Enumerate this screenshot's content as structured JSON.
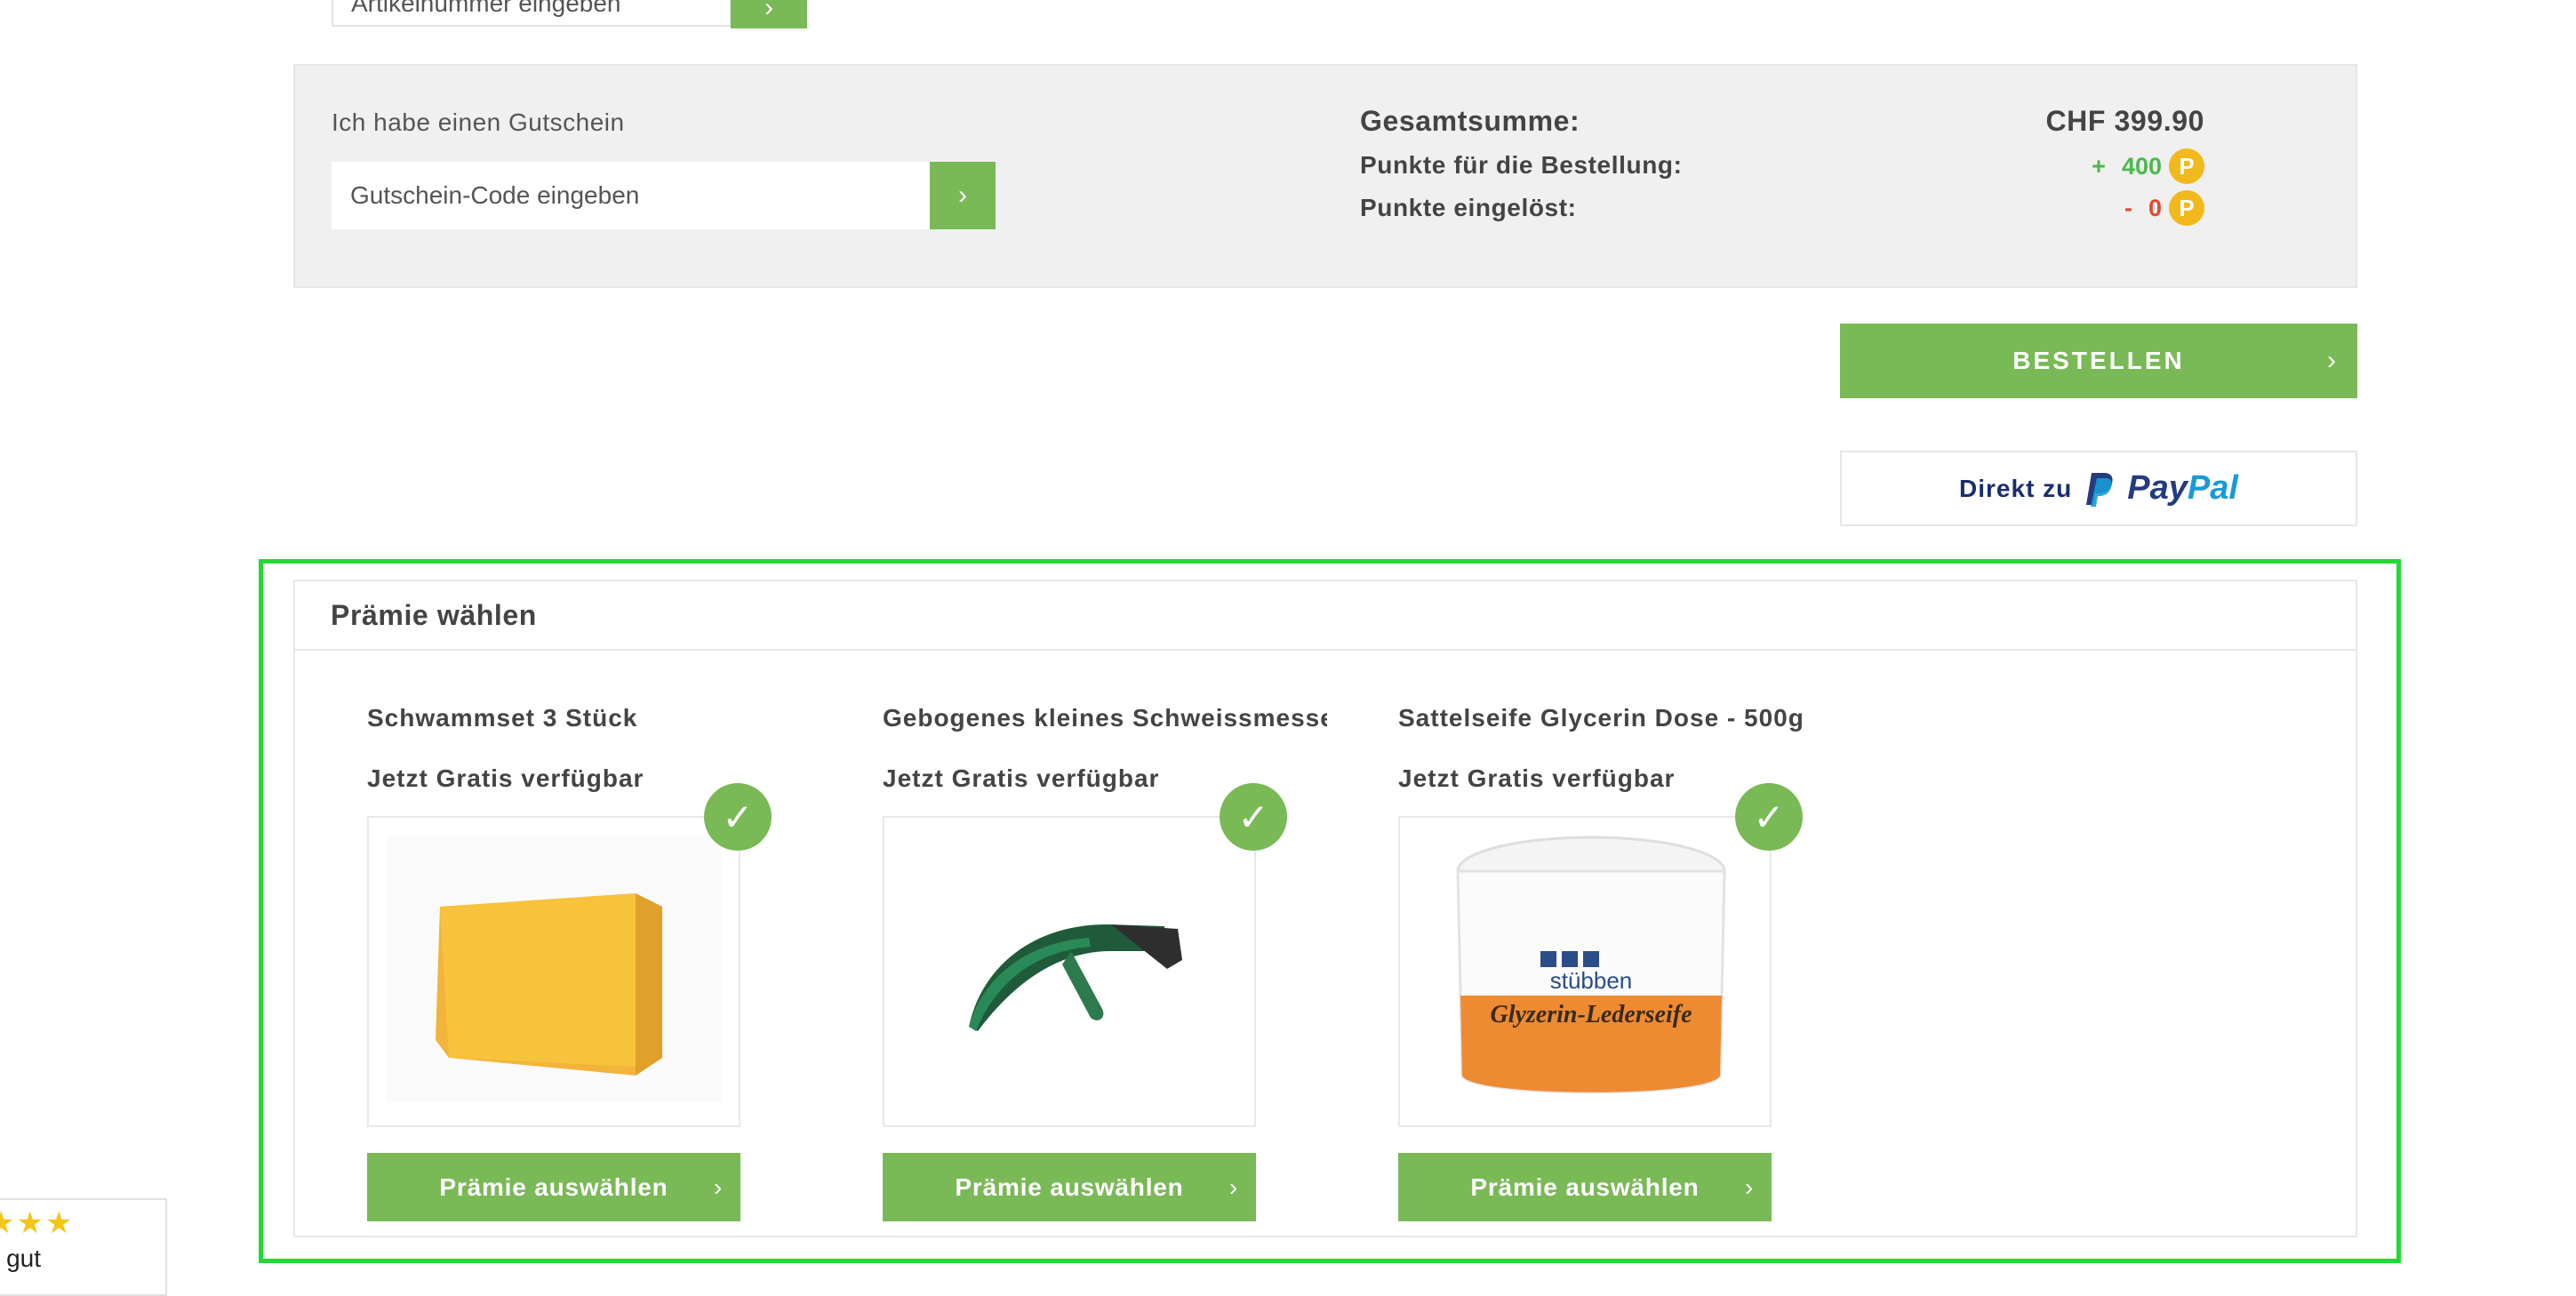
{
  "article": {
    "placeholder": "Artikelnummer eingeben",
    "submit_icon": "chevron-right-icon"
  },
  "voucher": {
    "label": "Ich habe einen Gutschein",
    "placeholder": "Gutschein-Code eingeben",
    "submit_icon": "chevron-right-icon"
  },
  "summary": {
    "total_label": "Gesamtsumme:",
    "total_value": "CHF 399.90",
    "points_label": "Punkte für die Bestellung:",
    "points_sign": "+",
    "points_value": "400",
    "redeemed_label": "Punkte eingelöst:",
    "redeemed_sign": "-",
    "redeemed_value": "0",
    "points_badge": "P"
  },
  "order": {
    "label": "BESTELLEN"
  },
  "paypal": {
    "label": "Direkt zu",
    "brand_dark": "Pay",
    "brand_light": "Pal"
  },
  "rewards": {
    "title": "Prämie wählen",
    "items": [
      {
        "name": "Schwammset 3 Stück",
        "availability": "Jetzt Gratis verfügbar",
        "button": "Prämie auswählen",
        "image": "yellow-sponge"
      },
      {
        "name": "Gebogenes kleines Schweissmesser",
        "availability": "Jetzt Gratis verfügbar",
        "button": "Prämie auswählen",
        "image": "sweat-scraper"
      },
      {
        "name": "Sattelseife Glycerin Dose - 500g",
        "availability": "Jetzt Gratis verfügbar",
        "button": "Prämie auswählen",
        "image": "saddle-soap-tin"
      }
    ],
    "tin_label_brand": "stübben",
    "tin_label_product": "Glyzerin-Lederseife"
  },
  "rating": {
    "stars": "★★★",
    "text": "r gut"
  },
  "colors": {
    "accent": "#79b956",
    "highlight": "#22d833",
    "points_plus": "#4cb84c",
    "points_minus": "#e04a2a",
    "badge": "#f1b91b"
  }
}
